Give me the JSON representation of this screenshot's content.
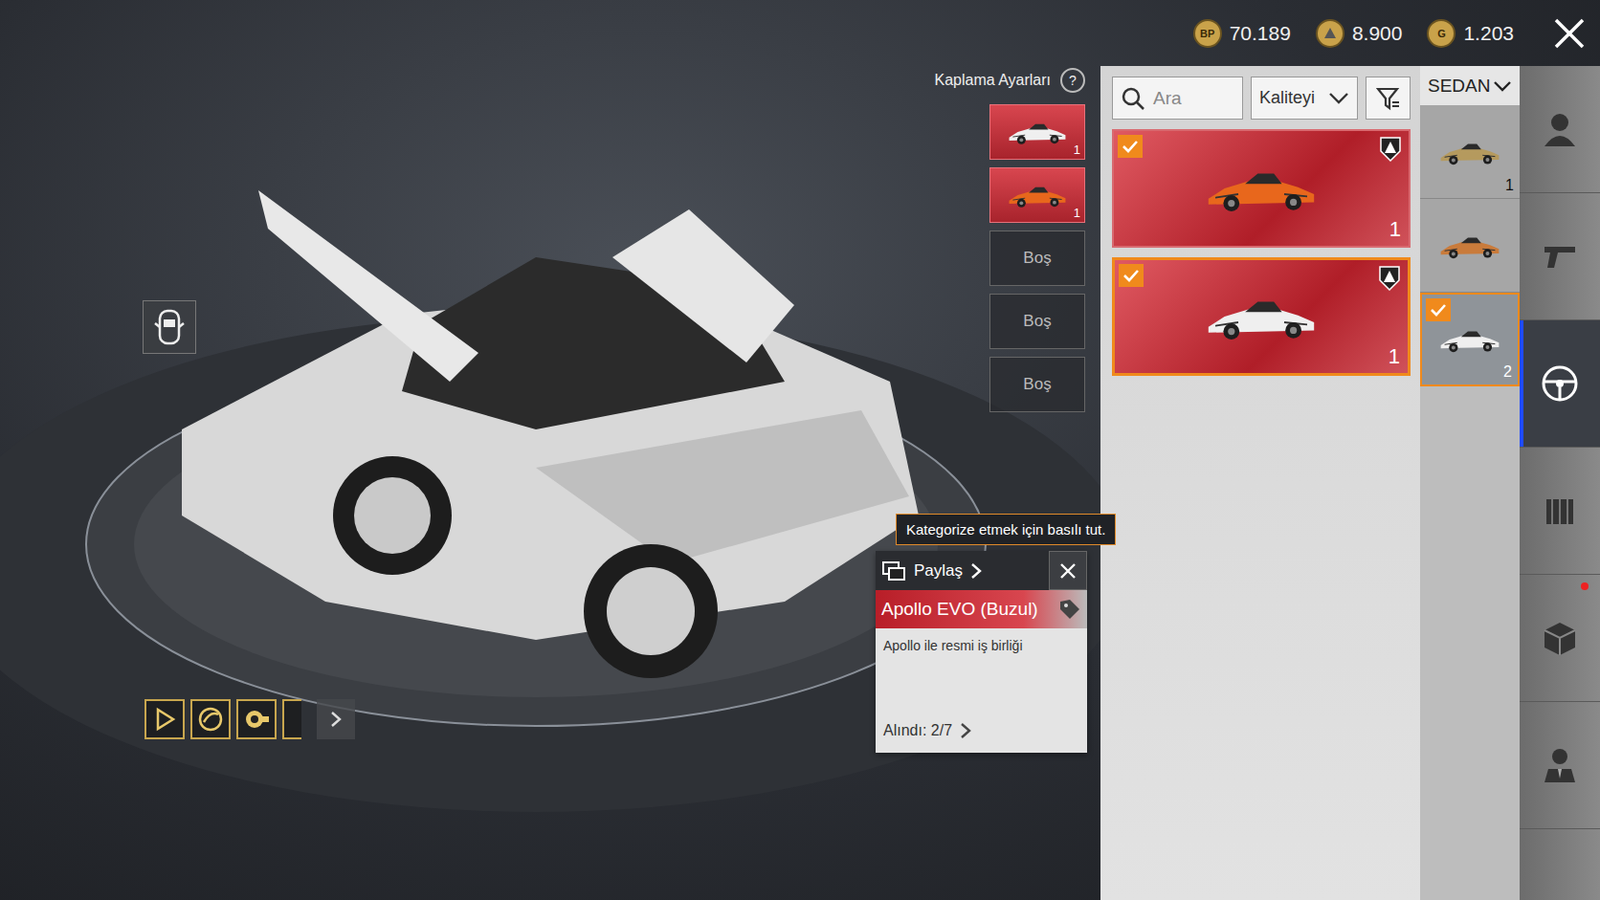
{
  "currencies": [
    {
      "symbol": "BP",
      "value": "70.189"
    },
    {
      "value": "8.900"
    },
    {
      "symbol": "G",
      "value": "1.203"
    }
  ],
  "skin_settings": {
    "title": "Kaplama Ayarları",
    "help": "?",
    "slots": [
      {
        "filled": true,
        "kind": "white",
        "count": "1"
      },
      {
        "filled": true,
        "kind": "orange",
        "count": "1"
      },
      {
        "filled": false,
        "label": "Boş"
      },
      {
        "filled": false,
        "label": "Boş"
      },
      {
        "filled": false,
        "label": "Boş"
      }
    ]
  },
  "panel": {
    "search": {
      "placeholder": "Ara"
    },
    "sort": {
      "label": "Kaliteyi"
    },
    "cards": [
      {
        "kind": "orange",
        "count": "1",
        "checked": true,
        "selected": false
      },
      {
        "kind": "white",
        "count": "1",
        "checked": true,
        "selected": true
      }
    ]
  },
  "category": {
    "label": "SEDAN",
    "items": [
      {
        "kind": "sedan",
        "count": "1",
        "checked": false,
        "selected": false
      },
      {
        "kind": "convertible",
        "count": "",
        "checked": false,
        "selected": false
      },
      {
        "kind": "white",
        "count": "2",
        "checked": true,
        "selected": true
      }
    ]
  },
  "rail": [
    {
      "kind": "character",
      "selected": false,
      "notify": false
    },
    {
      "kind": "weapon",
      "selected": false,
      "notify": false
    },
    {
      "kind": "vehicle",
      "selected": true,
      "notify": false
    },
    {
      "kind": "backpack",
      "selected": false,
      "notify": false
    },
    {
      "kind": "crate",
      "selected": false,
      "notify": true
    },
    {
      "kind": "agent",
      "selected": false,
      "notify": false
    }
  ],
  "tooltip": "Kategorize etmek için basılı tut.",
  "item_card": {
    "share": "Paylaş",
    "title": "Apollo EVO (Buzul)",
    "description": "Apollo ile resmi iş birliği",
    "obtained": "Alındı: 2/7"
  },
  "abilities": [
    {
      "kind": "play"
    },
    {
      "kind": "wing"
    },
    {
      "kind": "turbo"
    },
    {
      "kind": "moon"
    }
  ]
}
